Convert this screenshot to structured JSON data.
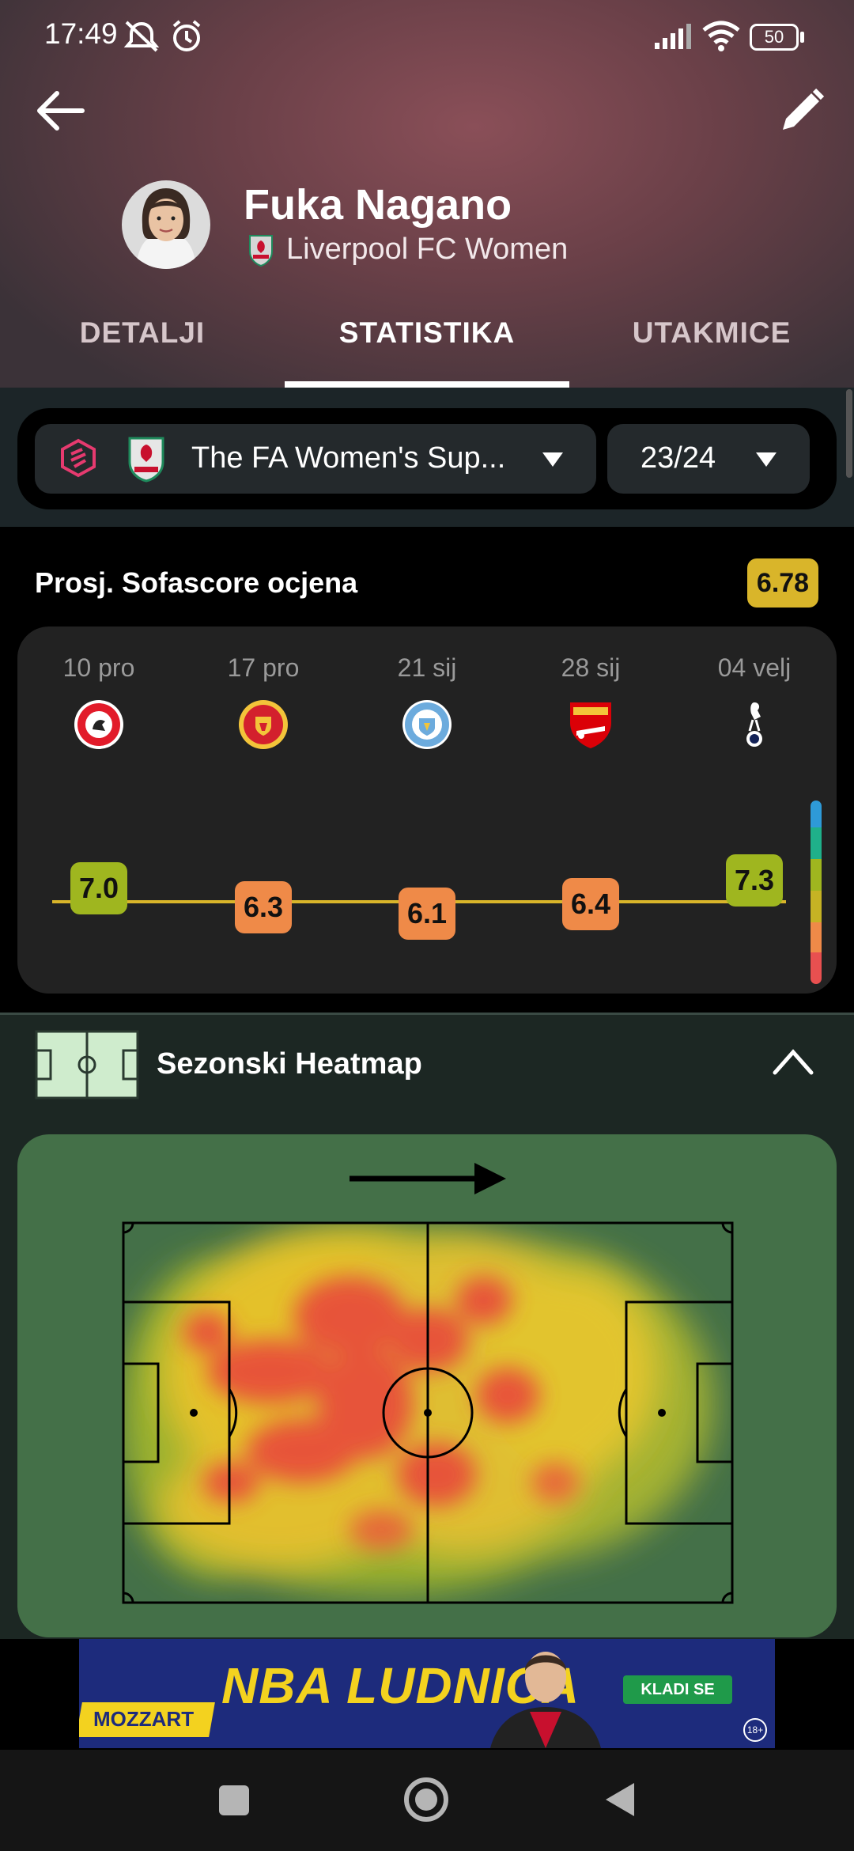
{
  "status_bar": {
    "time": "17:49",
    "battery": "50"
  },
  "player": {
    "name": "Fuka Nagano",
    "club": "Liverpool FC Women"
  },
  "tabs": [
    {
      "label": "DETALJI"
    },
    {
      "label": "STATISTIKA"
    },
    {
      "label": "UTAKMICE"
    }
  ],
  "filters": {
    "league": "The FA Women's Sup...",
    "season": "23/24"
  },
  "rating": {
    "title": "Prosj. Sofascore ocjena",
    "average": "6.78",
    "matches": [
      {
        "date": "10 pro",
        "opponent_icon": "bristol-city-icon",
        "rating": "7.0",
        "color": "#9fb61f"
      },
      {
        "date": "17 pro",
        "opponent_icon": "manchester-united-icon",
        "rating": "6.3",
        "color": "#ef8a48"
      },
      {
        "date": "21 sij",
        "opponent_icon": "manchester-city-icon",
        "rating": "6.1",
        "color": "#ef8a48"
      },
      {
        "date": "28 sij",
        "opponent_icon": "arsenal-icon",
        "rating": "6.4",
        "color": "#ef8a48"
      },
      {
        "date": "04 velj",
        "opponent_icon": "tottenham-icon",
        "rating": "7.3",
        "color": "#9fb61f"
      }
    ],
    "scale_colors": [
      "#2e9ad8",
      "#1fb08a",
      "#9fb61f",
      "#c6b324",
      "#ef8a48",
      "#e85050"
    ]
  },
  "heatmap": {
    "title": "Sezonski Heatmap"
  },
  "ad": {
    "brand": "MOZZART",
    "headline": "NBA LUDNICA",
    "cta": "KLADI SE",
    "age": "18+"
  },
  "colors": {
    "accent": "#d9b52a",
    "heat_field": "#447048"
  }
}
